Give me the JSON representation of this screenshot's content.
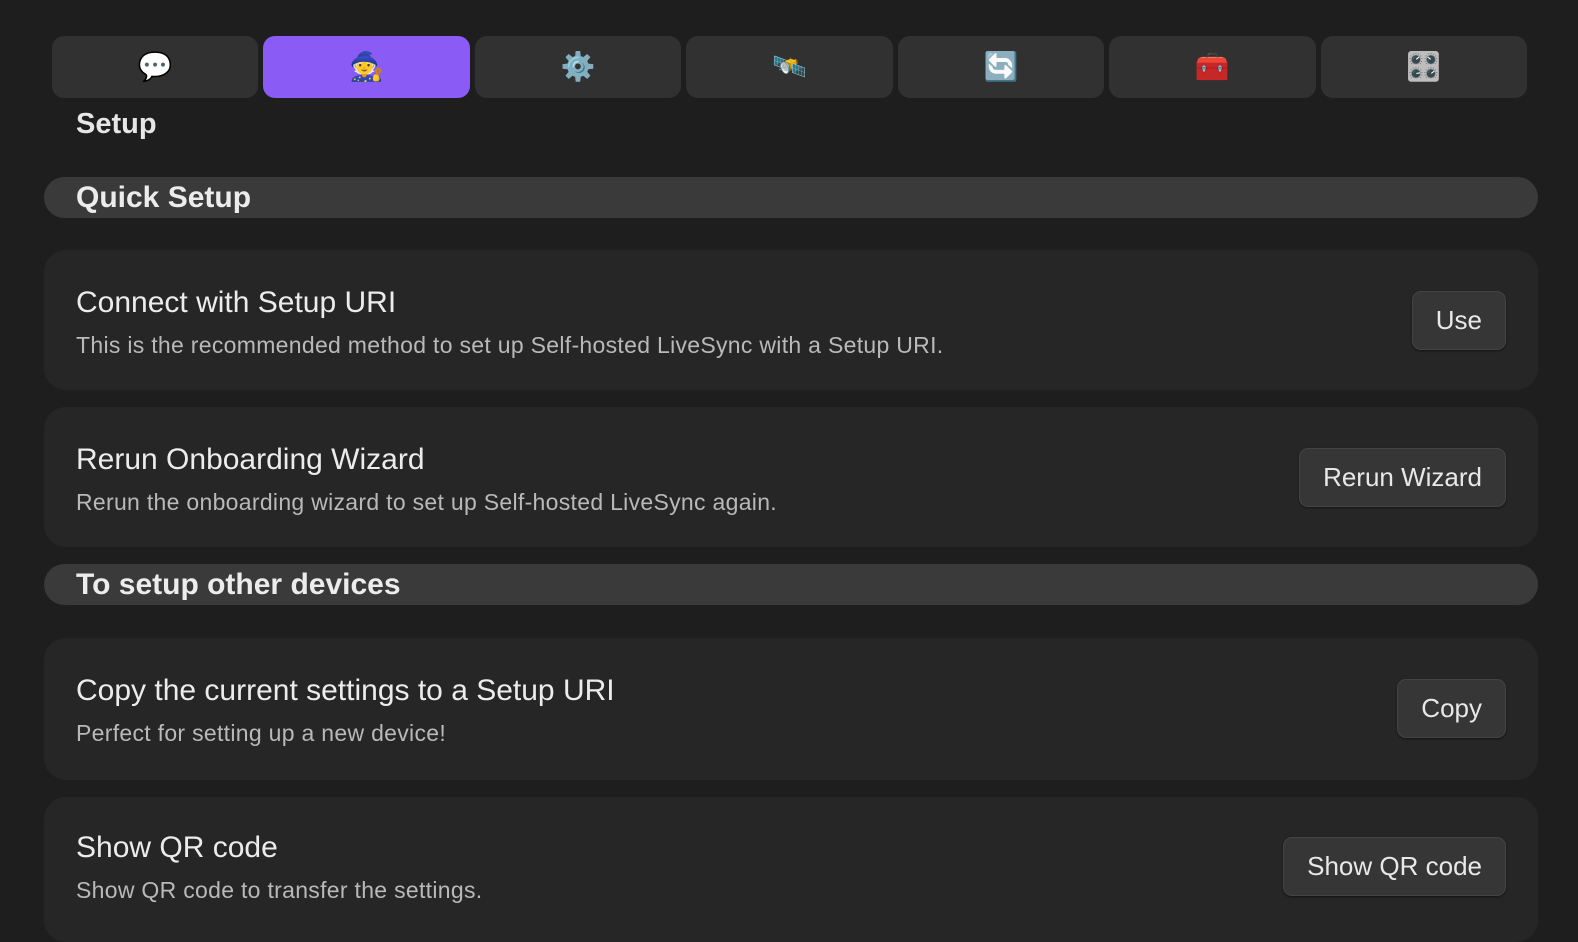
{
  "tabs": [
    {
      "icon": "💬",
      "icon_name": "speech-balloon-icon",
      "active": false
    },
    {
      "icon": "🧙",
      "icon_name": "wizard-icon",
      "active": true
    },
    {
      "icon": "⚙️",
      "icon_name": "gear-icon",
      "active": false
    },
    {
      "icon": "🛰️",
      "icon_name": "satellite-icon",
      "active": false
    },
    {
      "icon": "🔄",
      "icon_name": "sync-arrows-icon",
      "active": false
    },
    {
      "icon": "🧰",
      "icon_name": "toolbox-icon",
      "active": false
    },
    {
      "icon": "🎛️",
      "icon_name": "control-knobs-icon",
      "active": false
    }
  ],
  "page_title": "Setup",
  "sections": {
    "quick_setup": "Quick Setup",
    "other_devices": "To setup other devices"
  },
  "settings": {
    "connect_uri": {
      "name": "Connect with Setup URI",
      "desc": "This is the recommended method to set up Self-hosted LiveSync with a Setup URI.",
      "button": "Use"
    },
    "rerun_wizard": {
      "name": "Rerun Onboarding Wizard",
      "desc": "Rerun the onboarding wizard to set up Self-hosted LiveSync again.",
      "button": "Rerun Wizard"
    },
    "copy_settings": {
      "name": "Copy the current settings to a Setup URI",
      "desc": "Perfect for setting up a new device!",
      "button": "Copy"
    },
    "show_qr": {
      "name": "Show QR code",
      "desc": "Show QR code to transfer the settings.",
      "button": "Show QR code"
    }
  },
  "colors": {
    "background": "#1e1e1e",
    "accent": "#8a5cf5",
    "tab": "#313131",
    "card": "#262626",
    "section_header": "#3a3a3a"
  }
}
